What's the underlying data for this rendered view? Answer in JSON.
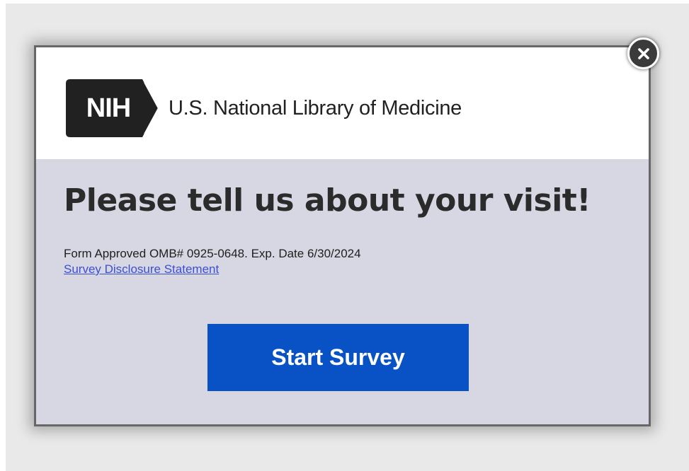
{
  "brand": {
    "mark_text": "NIH",
    "org_name": "U.S. National Library of Medicine"
  },
  "survey": {
    "headline": "Please tell us about your visit!",
    "omb_notice": "Form Approved OMB# 0925-0648. Exp. Date 6/30/2024",
    "disclosure_link": "Survey Disclosure Statement",
    "start_label": "Start Survey"
  },
  "icons": {
    "close": "close-icon",
    "nih_chevron": "chevron-right-icon"
  },
  "colors": {
    "button": "#0852c5",
    "body_background": "#d7d6e3",
    "link": "#3b4fd1",
    "logo_dark": "#212121"
  }
}
